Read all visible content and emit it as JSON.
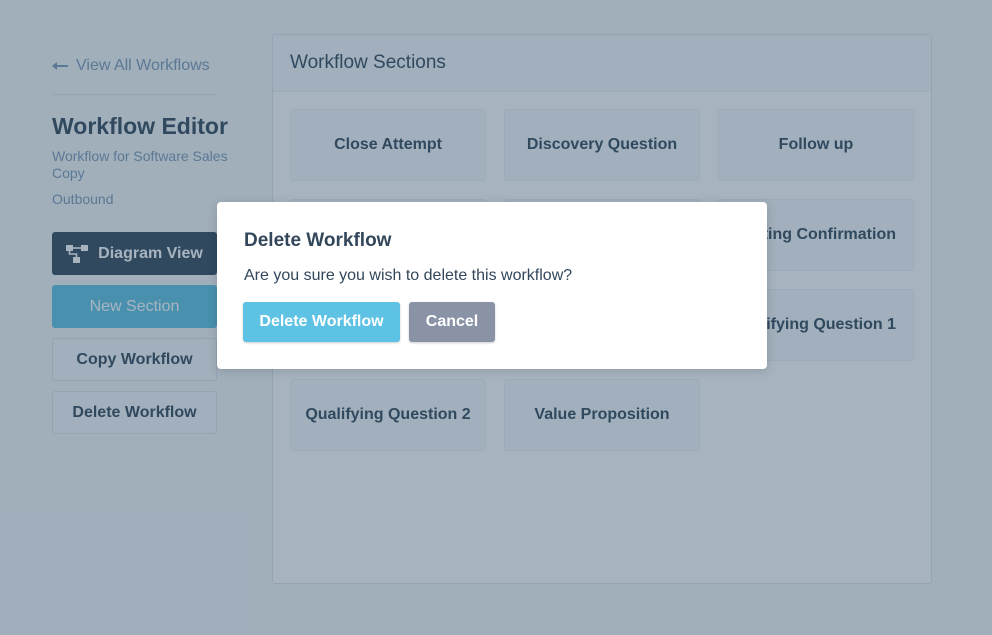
{
  "sidebar": {
    "back_link": "View All Workflows",
    "title": "Workflow Editor",
    "workflow_name": "Workflow for Software Sales Copy",
    "workflow_type": "Outbound",
    "buttons": {
      "diagram_view": "Diagram View",
      "new_section": "New Section",
      "copy_workflow": "Copy Workflow",
      "delete_workflow": "Delete Workflow"
    }
  },
  "main": {
    "title": "Workflow Sections",
    "sections": [
      "Close Attempt",
      "Discovery Question",
      "Follow up",
      "Meeting Confirmation",
      "Qualifying Question 1",
      "Qualifying Question 2",
      "Value Proposition"
    ]
  },
  "modal": {
    "title": "Delete Workflow",
    "message": "Are you sure you wish to delete this workflow?",
    "confirm_label": "Delete Workflow",
    "cancel_label": "Cancel"
  },
  "icons": {
    "back": "arrow-left-icon",
    "diagram": "diagram-icon"
  },
  "colors": {
    "primary_dark": "#33475b",
    "accent": "#5ec2e4",
    "cancel": "#8a93a6",
    "muted_text": "#7c98b6"
  }
}
